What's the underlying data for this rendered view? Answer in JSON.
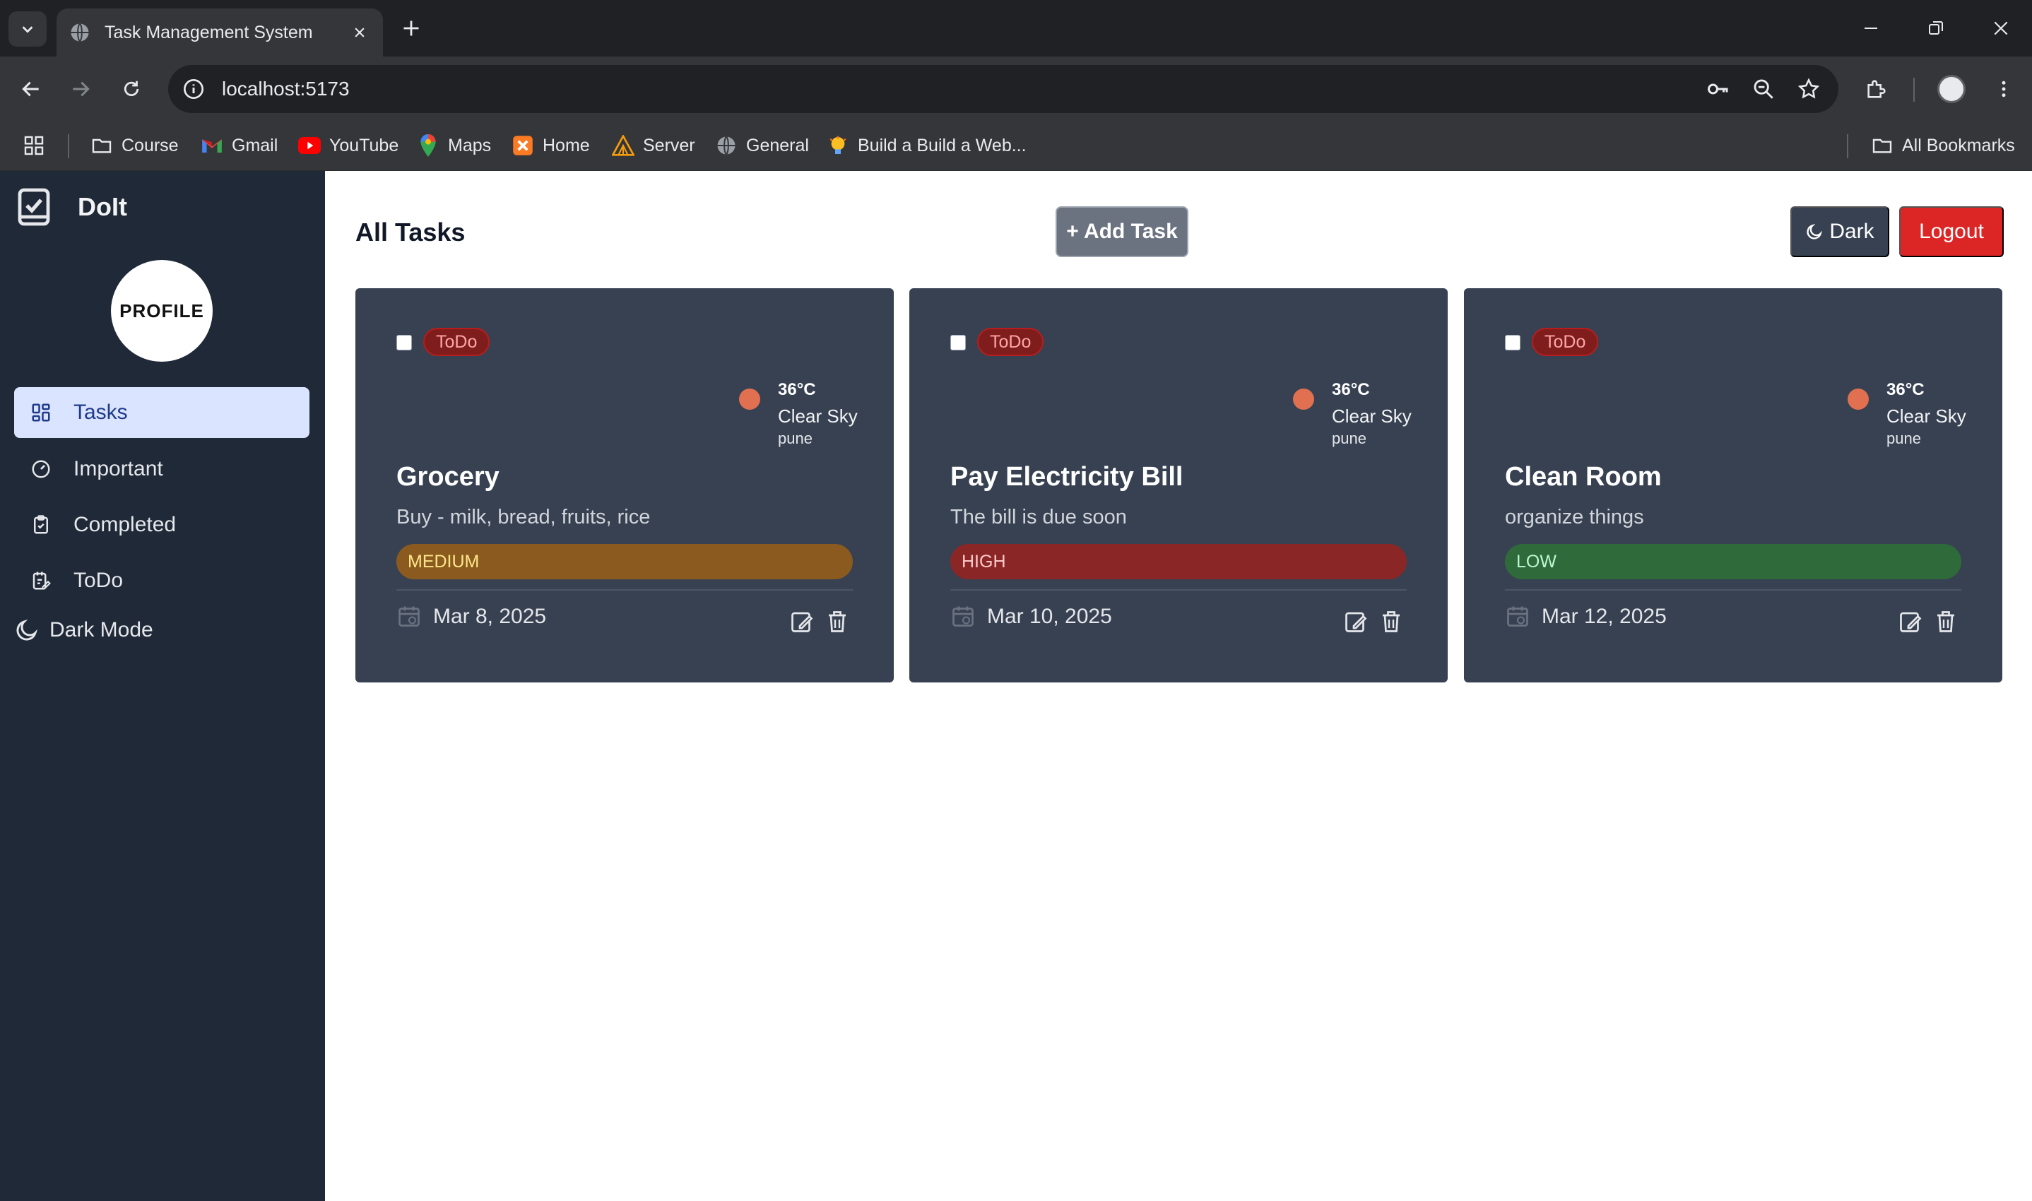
{
  "browser": {
    "tab_title": "Task Management System",
    "url": "localhost:5173",
    "bookmarks": [
      {
        "label": "Course",
        "icon": "folder-icon"
      },
      {
        "label": "Gmail",
        "icon": "gmail-icon"
      },
      {
        "label": "YouTube",
        "icon": "youtube-icon"
      },
      {
        "label": "Maps",
        "icon": "maps-icon"
      },
      {
        "label": "Home",
        "icon": "xampp-icon"
      },
      {
        "label": "Server",
        "icon": "server-icon"
      },
      {
        "label": "General",
        "icon": "globe-icon"
      },
      {
        "label": "Build a Build a Web...",
        "icon": "bulb-icon"
      }
    ],
    "all_bookmarks": "All Bookmarks"
  },
  "app": {
    "brand": "DoIt",
    "profile_text": "PROFILE",
    "nav": [
      {
        "label": "Tasks",
        "icon": "grid-icon",
        "active": true
      },
      {
        "label": "Important",
        "icon": "gauge-icon",
        "active": false
      },
      {
        "label": "Completed",
        "icon": "clipboard-check-icon",
        "active": false
      },
      {
        "label": "ToDo",
        "icon": "notepad-edit-icon",
        "active": false
      }
    ],
    "dark_mode_label": "Dark Mode"
  },
  "main": {
    "title": "All Tasks",
    "add_task": "+ Add Task",
    "dark_button": "Dark",
    "logout": "Logout"
  },
  "tasks": [
    {
      "status": "ToDo",
      "weather": {
        "temp": "36°C",
        "desc": "Clear Sky",
        "city": "pune"
      },
      "title": "Grocery",
      "description": "Buy - milk, bread, fruits, rice",
      "priority": "MEDIUM",
      "priority_bg": "#8b5a1e",
      "priority_fg": "#fde68a",
      "date": "Mar 8, 2025"
    },
    {
      "status": "ToDo",
      "weather": {
        "temp": "36°C",
        "desc": "Clear Sky",
        "city": "pune"
      },
      "title": "Pay Electricity Bill",
      "description": "The bill is due soon",
      "priority": "HIGH",
      "priority_bg": "#8b2626",
      "priority_fg": "#fecaca",
      "date": "Mar 10, 2025"
    },
    {
      "status": "ToDo",
      "weather": {
        "temp": "36°C",
        "desc": "Clear Sky",
        "city": "pune"
      },
      "title": "Clean Room",
      "description": "organize things",
      "priority": "LOW",
      "priority_bg": "#2f6b3a",
      "priority_fg": "#bbf7d0",
      "date": "Mar 12, 2025"
    }
  ],
  "colors": {
    "sidebar_bg": "#1f2937",
    "card_bg": "#374151",
    "logout": "#dc2626",
    "weather_dot": "#e07050"
  }
}
